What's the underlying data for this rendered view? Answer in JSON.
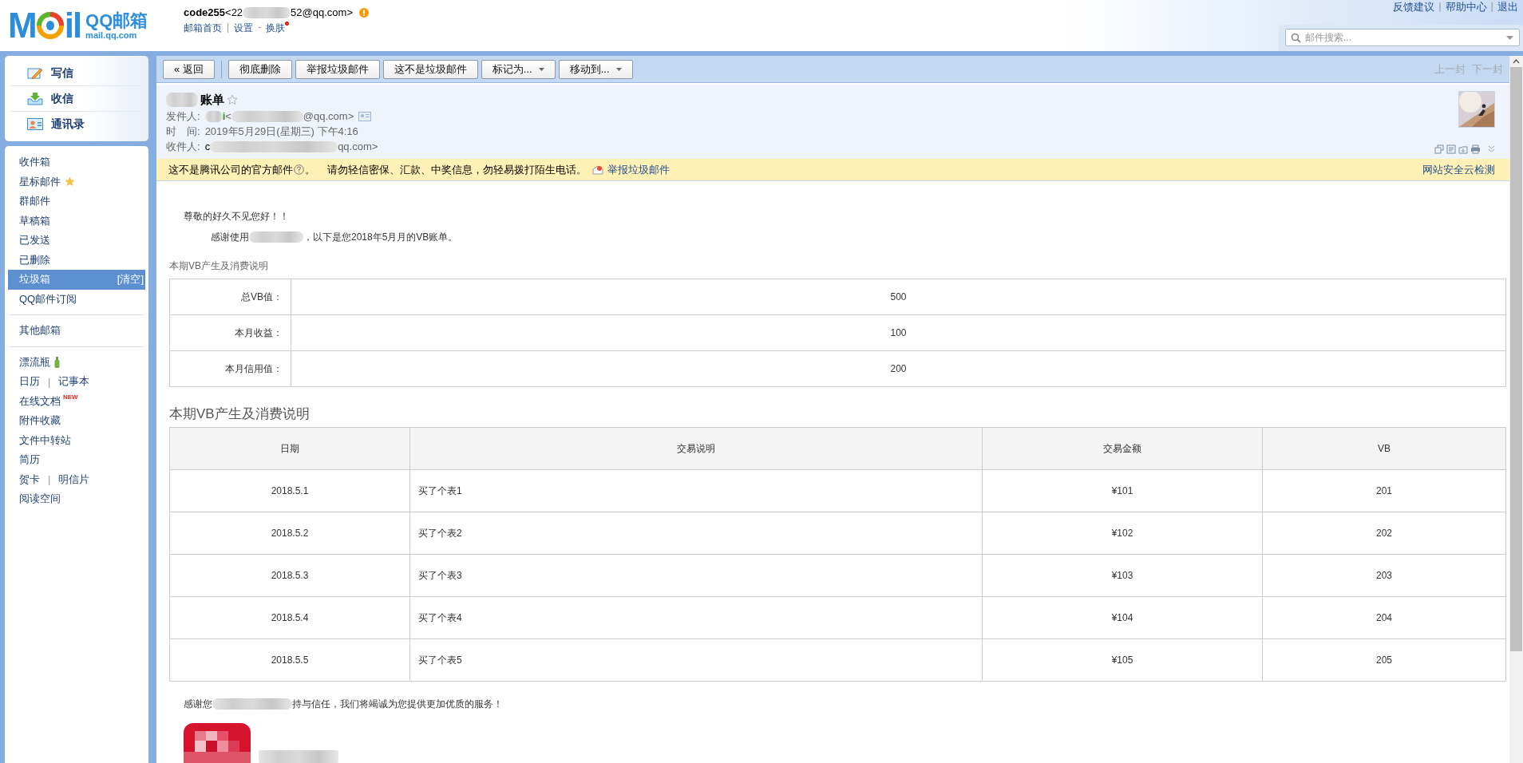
{
  "logo": {
    "left": "M",
    "right": "il",
    "product": "QQ邮箱",
    "domain": "mail.qq.com"
  },
  "account": {
    "name": "code255",
    "address_start": "<22",
    "address_end": "52@qq.com>"
  },
  "header_links": [
    {
      "label": "邮箱首页",
      "notify": false
    },
    {
      "label": "设置",
      "sep_before": "|",
      "notify": false
    },
    {
      "label": "换肤",
      "sep_before": "-",
      "notify": true
    }
  ],
  "top_links": {
    "separator": "|",
    "items": [
      "反馈建议",
      "帮助中心",
      "退出"
    ]
  },
  "search": {
    "placeholder": "邮件搜索..."
  },
  "quick_actions": [
    {
      "label": "写信",
      "kind": "compose"
    },
    {
      "label": "收信",
      "kind": "inbox"
    },
    {
      "label": "通讯录",
      "kind": "contacts"
    }
  ],
  "folders": [
    [
      {
        "labels": [
          "收件箱"
        ],
        "kind": "plain",
        "selected": false
      },
      {
        "labels": [
          "星标邮件"
        ],
        "kind": "star",
        "selected": false
      },
      {
        "labels": [
          "群邮件"
        ],
        "kind": "plain",
        "selected": false
      },
      {
        "labels": [
          "草稿箱"
        ],
        "kind": "plain",
        "selected": false
      },
      {
        "labels": [
          "已发送"
        ],
        "kind": "plain",
        "selected": false
      },
      {
        "labels": [
          "已删除"
        ],
        "kind": "plain",
        "selected": false
      },
      {
        "labels": [
          "垃圾箱"
        ],
        "kind": "plain",
        "selected": true,
        "action": "[清空]"
      },
      {
        "labels": [
          "QQ邮件订阅"
        ],
        "kind": "plain",
        "selected": false
      }
    ],
    [
      {
        "labels": [
          "其他邮箱"
        ],
        "kind": "plain",
        "selected": false
      }
    ],
    [
      {
        "labels": [
          "漂流瓶"
        ],
        "kind": "bottle",
        "selected": false
      },
      {
        "labels": [
          "日历",
          "记事本"
        ],
        "kind": "plain",
        "selected": false,
        "separator": "|"
      },
      {
        "labels": [
          "在线文档"
        ],
        "kind": "plain",
        "selected": false,
        "badge": "NEW"
      },
      {
        "labels": [
          "附件收藏"
        ],
        "kind": "plain",
        "selected": false
      },
      {
        "labels": [
          "文件中转站"
        ],
        "kind": "plain",
        "selected": false
      },
      {
        "labels": [
          "简历"
        ],
        "kind": "plain",
        "selected": false
      },
      {
        "labels": [
          "贺卡",
          "明信片"
        ],
        "kind": "plain",
        "selected": false,
        "separator": "|"
      },
      {
        "labels": [
          "阅读空间"
        ],
        "kind": "plain",
        "selected": false
      }
    ]
  ],
  "toolbar": {
    "buttons": [
      {
        "label": "« 返回",
        "kind": "plain"
      },
      {
        "label": "彻底删除",
        "kind": "plain"
      },
      {
        "label": "举报垃圾邮件",
        "kind": "plain"
      },
      {
        "label": "这不是垃圾邮件",
        "kind": "plain"
      },
      {
        "label": "标记为...",
        "kind": "menu"
      },
      {
        "label": "移动到...",
        "kind": "menu"
      }
    ],
    "nav": [
      {
        "label": "上一封",
        "disabled": true
      },
      {
        "label": "下一封",
        "disabled": true
      }
    ]
  },
  "mail": {
    "subject": "账单",
    "starred": false,
    "from_label": "发件人:",
    "from_name_end": "i",
    "from_address_start": "<",
    "from_address_end": "@qq.com>",
    "time_label": "时　间:",
    "time": "2019年5月29日(星期三) 下午4:16",
    "to_label": "收件人:",
    "to_start": "c",
    "to_end": "qq.com>"
  },
  "warning": {
    "text_start": "这不是腾讯公司的官方邮件",
    "text_end": "。",
    "advice": "请勿轻信密保、汇款、中奖信息，勿轻易拨打陌生电话。",
    "report": "举报垃圾邮件",
    "check": "网站安全云检测"
  },
  "body": {
    "greeting": "尊敬的好久不见您好！！",
    "thanks_start": "感谢使用",
    "thanks_end": "，以下是您2018年5月月的VB账单。",
    "summary_title": "本期VB产生及消费说明",
    "summary": [
      {
        "label": "总VB值：",
        "value": "500"
      },
      {
        "label": "本月收益：",
        "value": "100"
      },
      {
        "label": "本月信用值：",
        "value": "200"
      }
    ],
    "detail_title": "本期VB产生及消费说明",
    "columns": [
      "日期",
      "交易说明",
      "交易金额",
      "VB"
    ],
    "rows": [
      [
        "2018.5.1",
        "买了个表1",
        "¥101",
        "201"
      ],
      [
        "2018.5.2",
        "买了个表2",
        "¥102",
        "202"
      ],
      [
        "2018.5.3",
        "买了个表3",
        "¥103",
        "203"
      ],
      [
        "2018.5.4",
        "买了个表4",
        "¥104",
        "204"
      ],
      [
        "2018.5.5",
        "买了个表5",
        "¥105",
        "205"
      ]
    ],
    "footer_start": "感谢您",
    "footer_end": "持与信任，我们将竭诚为您提供更加优质的服务！"
  }
}
